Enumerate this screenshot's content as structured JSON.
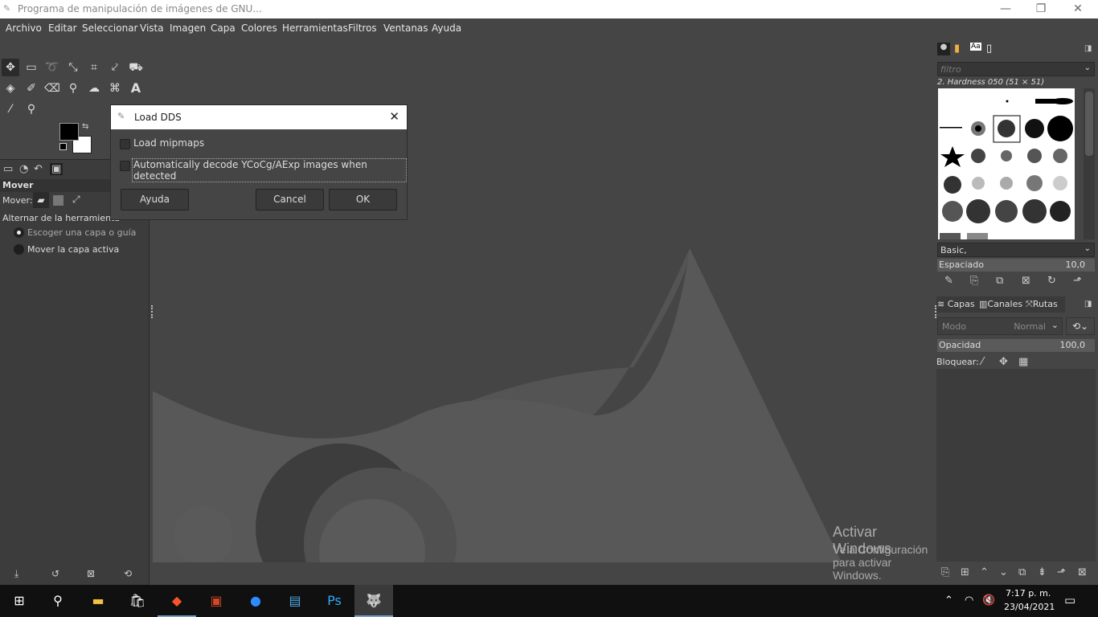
{
  "window": {
    "title": "Programa de manipulación de imágenes de GNU...",
    "minimize": "—",
    "maximize": "❐",
    "close": "✕"
  },
  "menu": [
    "Archivo",
    "Editar",
    "Seleccionar",
    "Vista",
    "Imagen",
    "Capa",
    "Colores",
    "Herramientas",
    "Filtros",
    "Ventanas",
    "Ayuda"
  ],
  "tool_options": {
    "title": "Mover",
    "move_label": "Mover:",
    "toggle_label": "Alternar de la herramienta",
    "option_pick": "Escoger una capa o guía",
    "option_active": "Mover la capa activa"
  },
  "dialog": {
    "title": "Load DDS",
    "load_mipmaps": "Load mipmaps",
    "auto_decode": "Automatically decode YCoCg/AExp images when detected",
    "help": "Ayuda",
    "cancel": "Cancel",
    "ok": "OK"
  },
  "brushes": {
    "filter_placeholder": "filtro",
    "current": "2. Hardness 050 (51 × 51)",
    "tag": "Basic,",
    "spacing_label": "Espaciado",
    "spacing_value": "10,0"
  },
  "layers": {
    "tab_layers": "Capas",
    "tab_channels": "Canales",
    "tab_paths": "Rutas",
    "mode_label": "Modo",
    "mode_value": "Normal",
    "opacity_label": "Opacidad",
    "opacity_value": "100,0",
    "lock_label": "Bloquear:"
  },
  "watermark": {
    "line1": "Activar Windows",
    "line2": "Ve a Configuración para activar Windows."
  },
  "clock": {
    "time": "7:17 p. m.",
    "date": "23/04/2021"
  }
}
